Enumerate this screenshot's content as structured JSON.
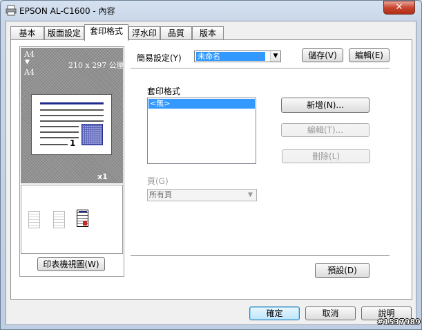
{
  "window": {
    "title": "EPSON AL-C1600 - 內容",
    "close_label": "✕"
  },
  "tabs": [
    {
      "label": "基本"
    },
    {
      "label": "版面設定"
    },
    {
      "label": "套印格式"
    },
    {
      "label": "浮水印"
    },
    {
      "label": "品質"
    },
    {
      "label": "版本"
    }
  ],
  "active_tab_index": 2,
  "preview": {
    "paper_src": "A4",
    "arrow": "▼",
    "paper_dst": "A4",
    "size": "210 x 297 公厘",
    "page_number": "1",
    "copies": "x1",
    "printer_view_button": "印表機視圖(W)",
    "accent_color": "#1f2a8c"
  },
  "simple_settings": {
    "label": "簡易設定(Y)",
    "value": "未命名",
    "save_button": "儲存(V)",
    "edit_button": "編輯(E)"
  },
  "overlay": {
    "group_label": "套印格式",
    "items": [
      "<無>"
    ],
    "new_button": "新增(N)...",
    "edit_button": "編輯(T)...",
    "delete_button": "刪除(L)"
  },
  "pages": {
    "label": "頁(G)",
    "value": "所有頁"
  },
  "default_button": "預設(D)",
  "footer": {
    "ok": "確定",
    "cancel": "取消",
    "help": "說明"
  },
  "watermark_id": "#1537989"
}
